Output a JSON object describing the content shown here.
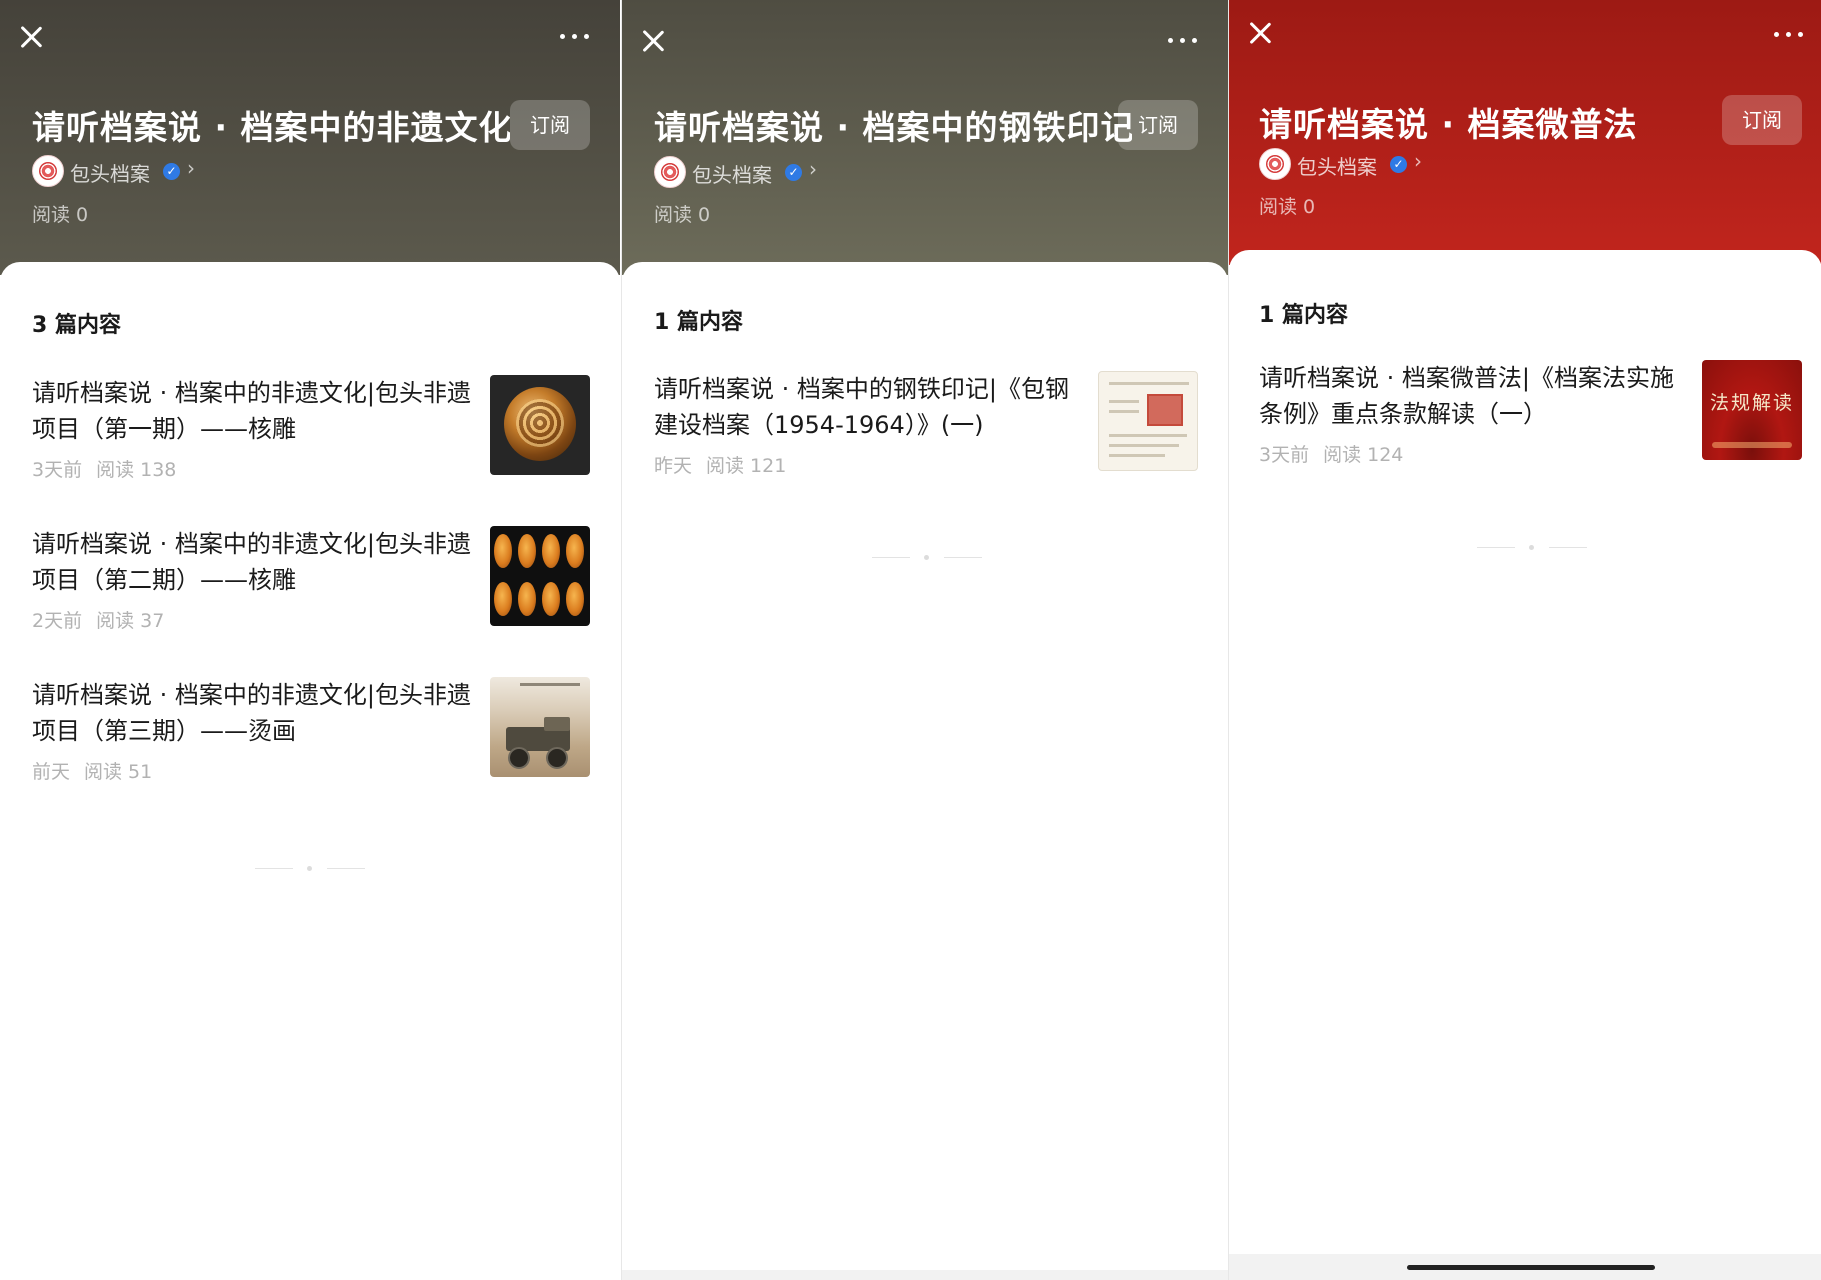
{
  "panels": [
    {
      "header": {
        "title": "请听档案说 · 档案中的非遗文化|",
        "subscribe_label": "订阅",
        "account_name": "包头档案",
        "reads": "阅读 0"
      },
      "content_count": "3 篇内容",
      "articles": [
        {
          "title": "请听档案说 · 档案中的非遗文化|包头非遗项目（第一期）——核雕",
          "time": "3天前",
          "reads": "阅读 138",
          "thumbnail": "carved-walnut"
        },
        {
          "title": "请听档案说 · 档案中的非遗文化|包头非遗项目（第二期）——核雕",
          "time": "2天前",
          "reads": "阅读 37",
          "thumbnail": "carved-seeds-grid"
        },
        {
          "title": "请听档案说 · 档案中的非遗文化|包头非遗项目（第三期）——烫画",
          "time": "前天",
          "reads": "阅读 51",
          "thumbnail": "mining-truck-painting"
        }
      ]
    },
    {
      "header": {
        "title": "请听档案说 · 档案中的钢铁印记",
        "subscribe_label": "订阅",
        "account_name": "包头档案",
        "reads": "阅读 0"
      },
      "content_count": "1 篇内容",
      "articles": [
        {
          "title": "请听档案说 · 档案中的钢铁印记|《包钢建设档案（1954-1964）》(一)",
          "time": "昨天",
          "reads": "阅读 121",
          "thumbnail": "archive-document"
        }
      ]
    },
    {
      "header": {
        "title": "请听档案说 · 档案微普法",
        "subscribe_label": "订阅",
        "account_name": "包头档案",
        "reads": "阅读 0"
      },
      "content_count": "1 篇内容",
      "articles": [
        {
          "title": "请听档案说 · 档案微普法|《档案法实施条例》重点条款解读（一）",
          "time": "3天前",
          "reads": "阅读 124",
          "thumbnail": "law-interpretation-banner",
          "thumbnail_text": "法规解读"
        }
      ]
    }
  ],
  "icons": {
    "close": "close-icon",
    "more": "more-options-icon",
    "verified": "verified-badge-icon",
    "chevron": "chevron-right-icon"
  },
  "colors": {
    "header_panel_1": "#4f4c42",
    "header_panel_2": "#5e5d4d",
    "header_panel_3": "#b01f18",
    "verified_blue": "#2f7ae5",
    "meta_gray": "#b2b2b2"
  }
}
